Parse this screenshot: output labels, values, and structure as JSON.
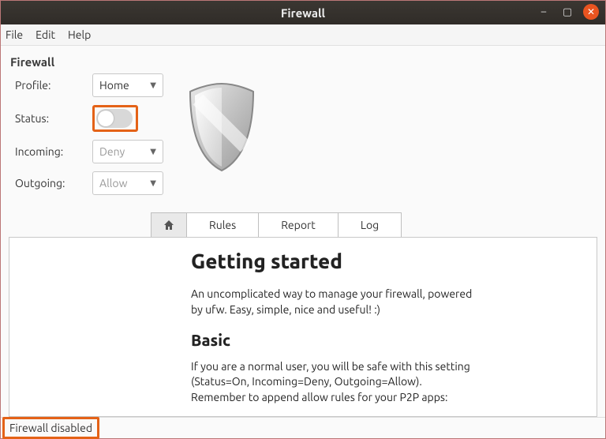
{
  "window": {
    "title": "Firewall"
  },
  "menu": {
    "file": "File",
    "edit": "Edit",
    "help": "Help"
  },
  "section": {
    "header": "Firewall"
  },
  "form": {
    "profile_label": "Profile:",
    "profile_value": "Home",
    "status_label": "Status:",
    "incoming_label": "Incoming:",
    "incoming_value": "Deny",
    "outgoing_label": "Outgoing:",
    "outgoing_value": "Allow"
  },
  "tabs": {
    "rules": "Rules",
    "report": "Report",
    "log": "Log"
  },
  "doc": {
    "h1": "Getting started",
    "p1": "An uncomplicated way to manage your firewall, powered by ufw. Easy, simple, nice and useful! :)",
    "h2": "Basic",
    "p2": "If you are a normal user, you will be safe with this setting (Status=On, Incoming=Deny, Outgoing=Allow). Remember to append allow rules for your P2P apps:"
  },
  "status": {
    "text": "Firewall disabled"
  }
}
